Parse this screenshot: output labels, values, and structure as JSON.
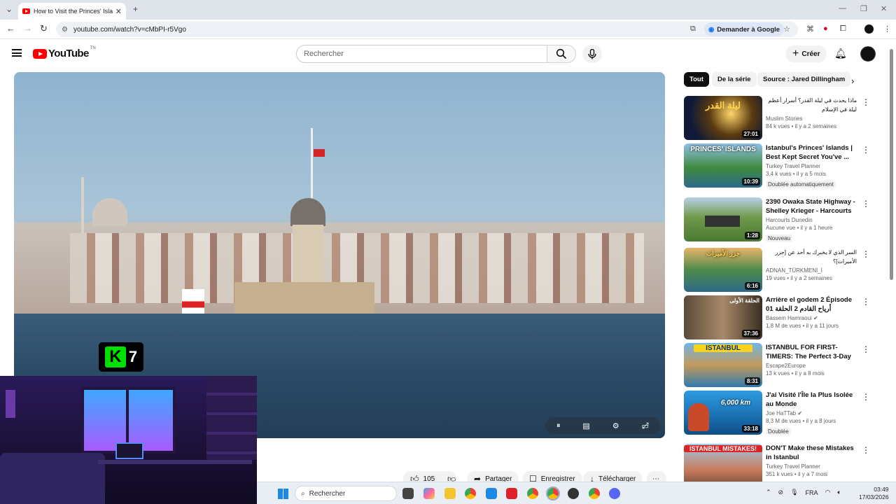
{
  "browser": {
    "tab_title": "How to Visit the Princes' Islands",
    "url": "youtube.com/watch?v=cMbPI-r5Vgo",
    "ask_google": "Demander à Google"
  },
  "header": {
    "logo": "YouTube",
    "region": "TN",
    "search_placeholder": "Rechercher",
    "create": "Créer"
  },
  "overlay": {
    "k7_letter": "K",
    "k7_number": "7"
  },
  "actions": {
    "likes": "105",
    "share": "Partager",
    "save": "Enregistrer",
    "download": "Télécharger"
  },
  "chips": [
    "Tout",
    "De la série",
    "Source : Jared Dillingham"
  ],
  "recommendations": [
    {
      "title": "ماذا يحدث في ليلة القدر؟ أسرار أعظم ليلة في الإسلام",
      "rtl": true,
      "channel": "Muslim Stories",
      "stats": "84 k vues • il y a 2 semaines",
      "duration": "27:01",
      "badge": "",
      "thumb_text": "ليلة القدر"
    },
    {
      "title": "Istanbul's Princes' Islands | Best Kept Secret You've ...",
      "rtl": false,
      "channel": "Turkey Travel Planner",
      "stats": "3,4 k vues • il y a 5 mois",
      "duration": "10:39",
      "badge": "Doublée automatiquement",
      "thumb_text": "PRINCES' ISLANDS"
    },
    {
      "title": "2390 Owaka State Highway - Shelley Krieger - Harcourts",
      "rtl": false,
      "channel": "Harcourts Dunedin",
      "stats": "Aucune vue • il y a 1 heure",
      "duration": "1:28",
      "badge": "Nouveau",
      "thumb_text": ""
    },
    {
      "title": "السر الذي لا يخبرك به أحد عن [جزر الأميرات]؟",
      "rtl": true,
      "channel": "ADNAN_TÜRKMENİ_İ",
      "stats": "19 vues • il y a 2 semaines",
      "duration": "6:16",
      "badge": "",
      "thumb_text": "جزر الأميرات"
    },
    {
      "title": "Arrière el godem 2 Épisode 01 أرياح القادم 2 الحلقة",
      "rtl": false,
      "channel": "Bassem Hamraoui",
      "stats": "1,8 M de vues • il y a 11 jours",
      "duration": "37:36",
      "badge": "",
      "thumb_text": "الحلقة الأولى"
    },
    {
      "title": "ISTANBUL FOR FIRST-TIMERS: The Perfect 3-Day ...",
      "rtl": false,
      "channel": "Escape2Europe",
      "stats": "13 k vues • il y a 8 mois",
      "duration": "8:31",
      "badge": "",
      "thumb_text": "ISTANBUL"
    },
    {
      "title": "J'ai Visité l'Île la Plus Isolée au Monde",
      "rtl": false,
      "channel": "Joe HaTTab",
      "stats": "8,3 M de vues • il y a 8 jours",
      "duration": "33:18",
      "badge": "Doublée",
      "thumb_text": "6,000 km"
    },
    {
      "title": "DON'T Make these Mistakes in Istanbul",
      "rtl": false,
      "channel": "Turkey Travel Planner",
      "stats": "351 k vues • il y a 7 mois",
      "duration": "",
      "badge": "",
      "thumb_text": "ISTANBUL MISTAKES!"
    }
  ],
  "taskbar": {
    "search": "Rechercher",
    "lang": "FRA",
    "time": "03:49",
    "date": "17/03/2026"
  },
  "colors": {
    "yt_red": "#ff0000",
    "k7_green": "#00e000"
  }
}
